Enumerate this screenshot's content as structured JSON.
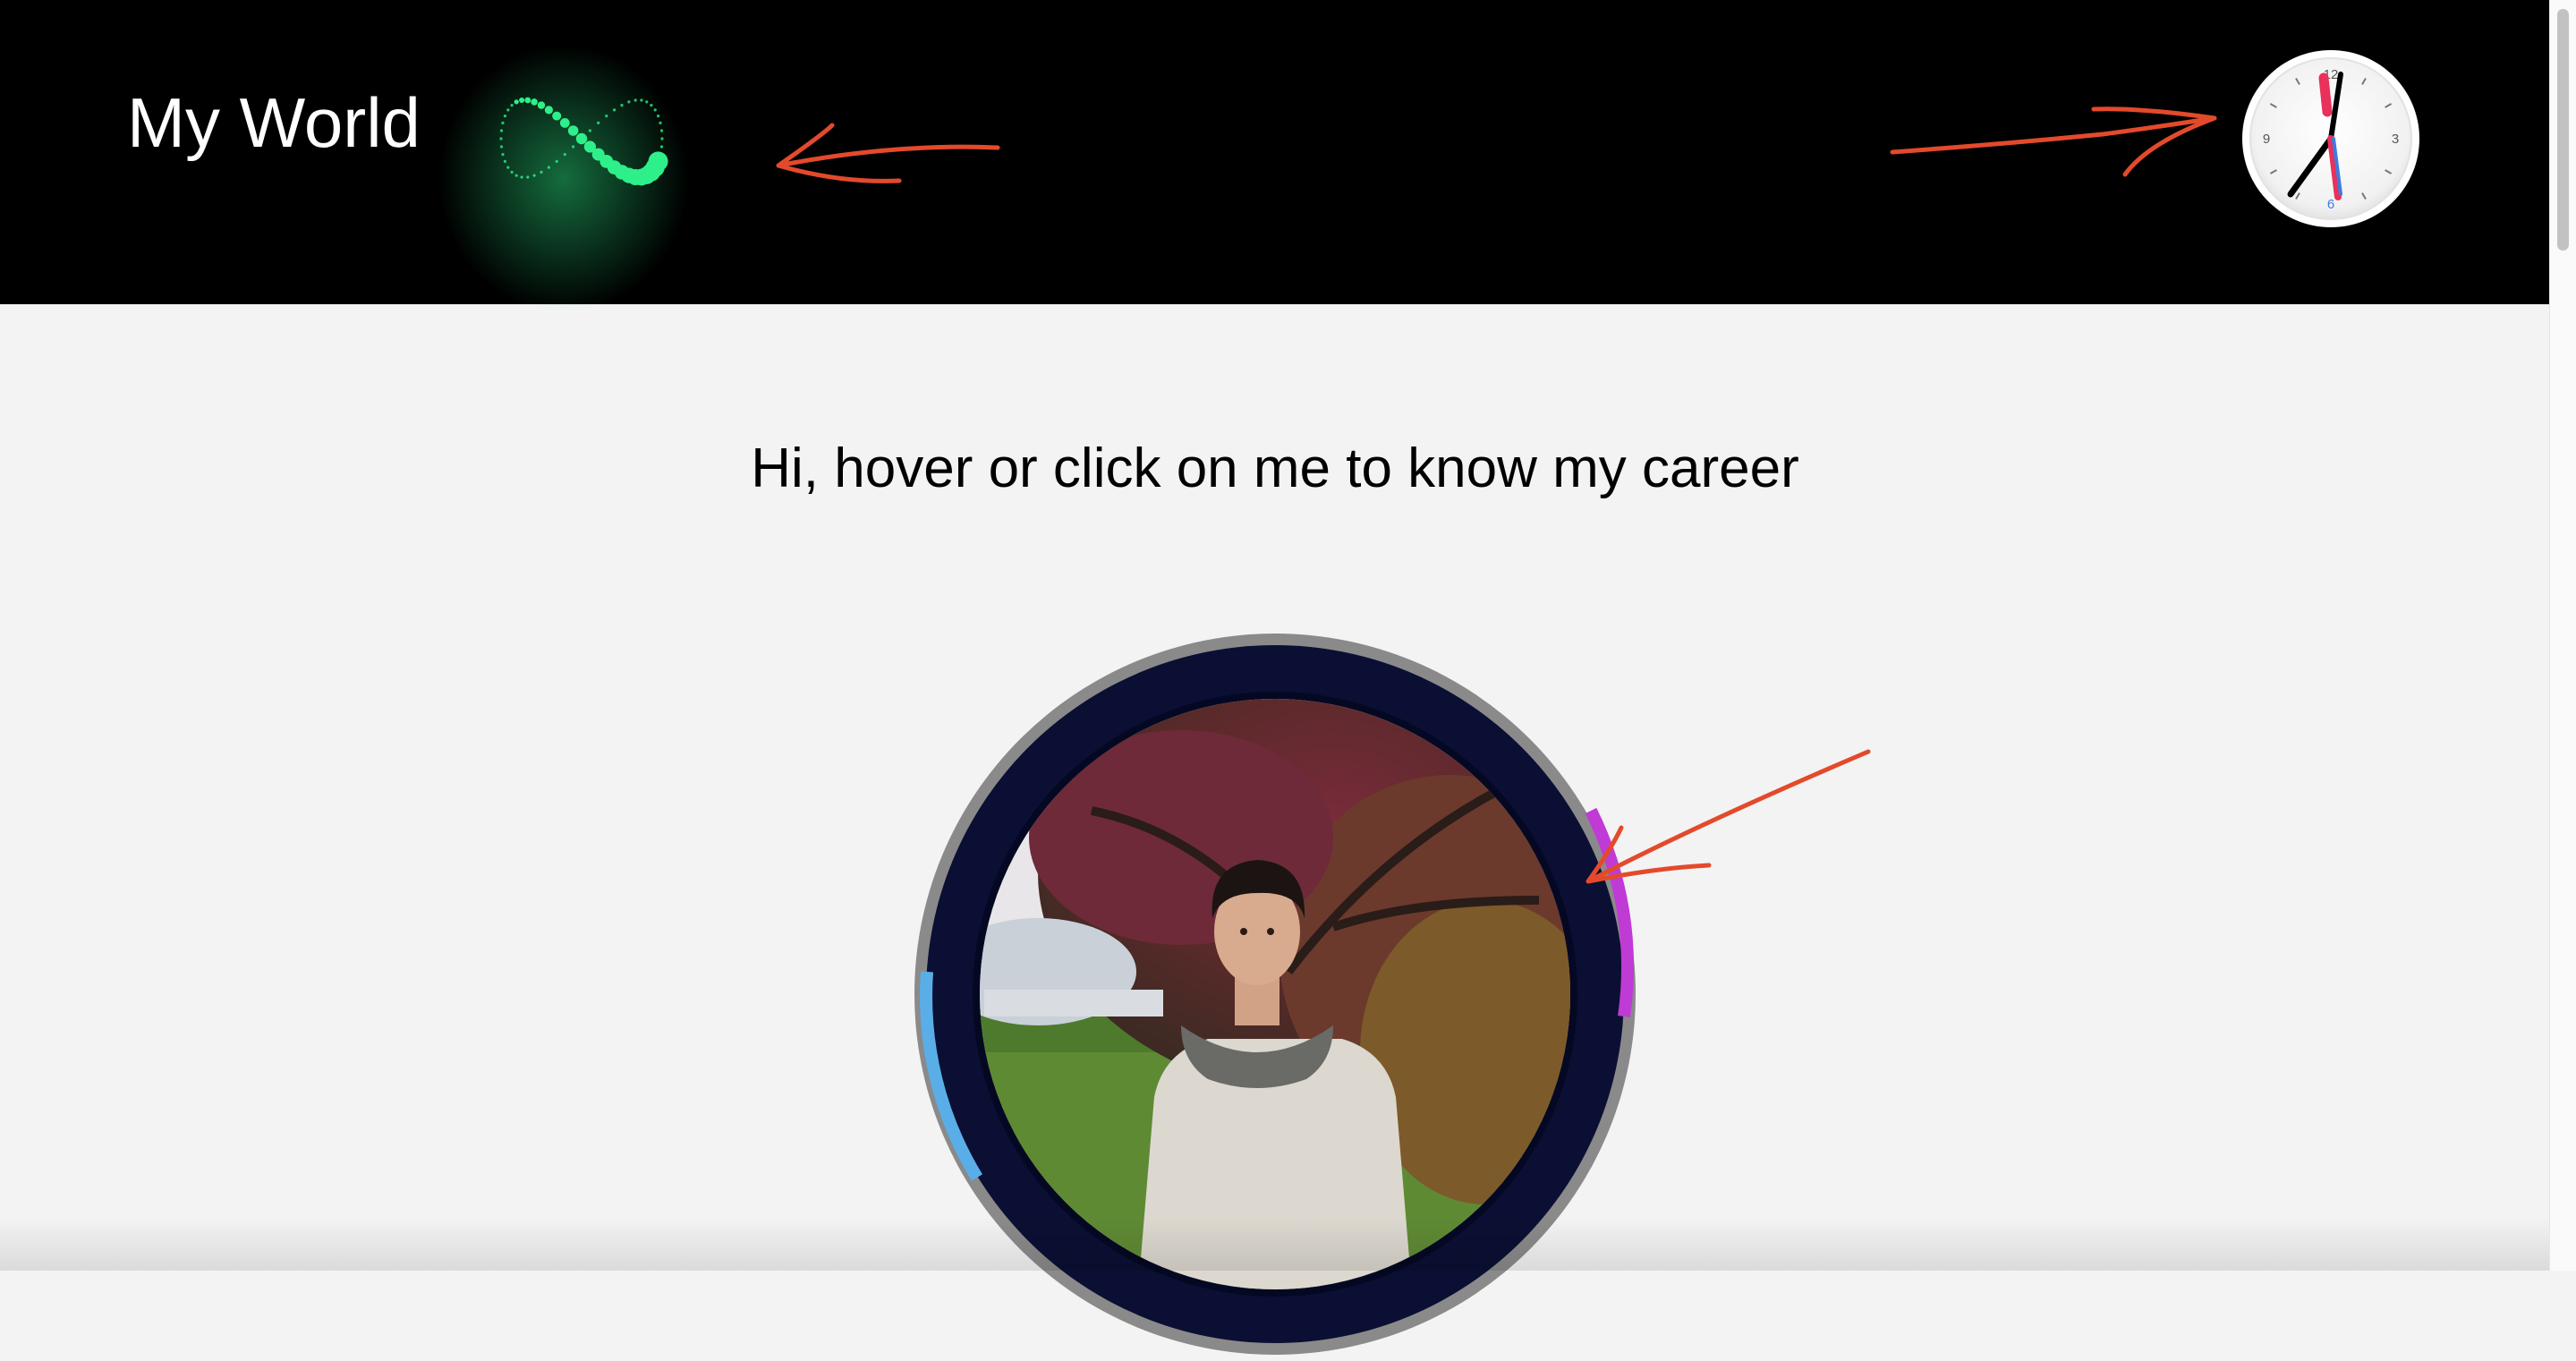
{
  "header": {
    "title": "My World",
    "background": "#000000",
    "loader_icon": "infinity-dots-loader-icon",
    "loader_color": "#2ef08a",
    "clock": {
      "icon": "analog-clock-icon",
      "numerals": [
        "12",
        "3",
        "6",
        "9"
      ],
      "hour_hand_color": "#000000",
      "minute_hand_color": "#e8315b",
      "second_hand_color": "#3c7ce0"
    }
  },
  "main": {
    "intro_text": "Hi, hover or click on me to know my career",
    "avatar": {
      "icon": "profile-photo",
      "ring_color": "#0b0f33",
      "outer_ring_color": "#8a8a8a",
      "accent_right": "#c03ad6",
      "accent_left": "#5aaee8"
    }
  },
  "annotations": {
    "arrow_color": "#e34a2b",
    "arrows": [
      "arrow-to-loader",
      "arrow-to-clock",
      "arrow-to-avatar-ring"
    ]
  }
}
